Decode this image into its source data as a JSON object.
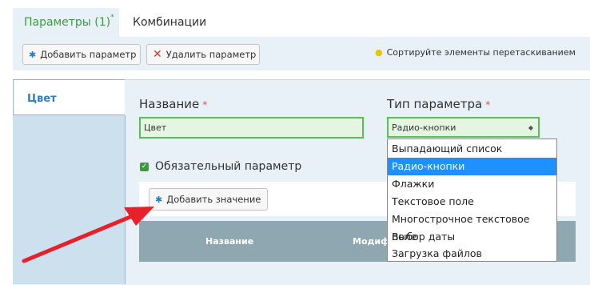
{
  "tabs": {
    "params_label": "Параметры (1)",
    "params_sup": "*",
    "combinations_label": "Комбинации"
  },
  "toolbar": {
    "add_param_label": "Добавить параметр",
    "delete_param_label": "Удалить параметр",
    "sort_hint": "Сортируйте элементы перетаскиванием"
  },
  "sidebar": {
    "active_item": "Цвет"
  },
  "form": {
    "name_label": "Название",
    "name_required": "*",
    "name_value": "Цвет",
    "type_label": "Тип параметра",
    "type_required": "*",
    "type_value": "Радио-кнопки",
    "required_checkbox_label": "Обязательный параметр",
    "required_checked": true,
    "add_value_label": "Добавить значение"
  },
  "values_table": {
    "columns": [
      "Название",
      "Модиф"
    ]
  },
  "type_dropdown": {
    "options": [
      "Выпадающий список",
      "Радио-кнопки",
      "Флажки",
      "Текстовое поле",
      "Многострочное текстовое поле",
      "Выбор даты",
      "Загрузка файлов"
    ],
    "selected_index": 1
  },
  "colors": {
    "accent_green": "#3a9c3f",
    "selected_blue": "#1e90ff",
    "annotation_arrow": "#e8202a"
  },
  "icons": {
    "add": "snowflake-icon",
    "delete": "close-icon",
    "hint": "lightbulb-icon",
    "select": "sort-arrows-icon"
  }
}
